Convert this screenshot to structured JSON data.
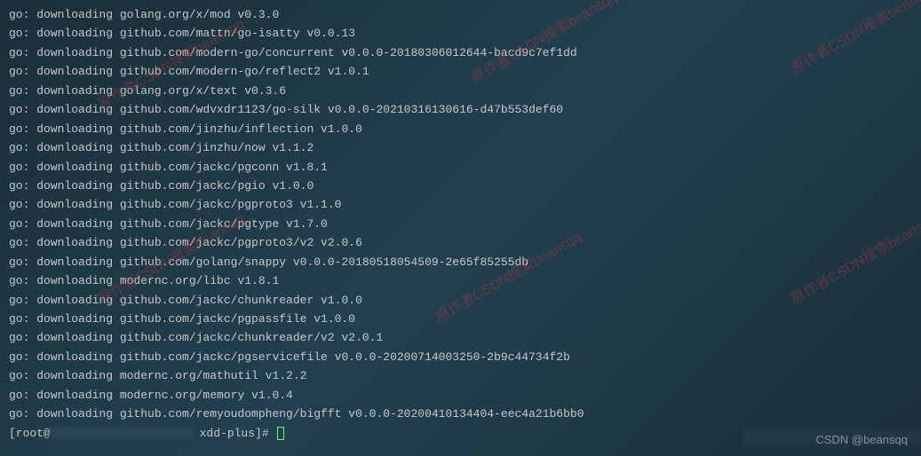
{
  "lines": [
    "go: downloading golang.org/x/mod v0.3.0",
    "go: downloading github.com/mattn/go-isatty v0.0.13",
    "go: downloading github.com/modern-go/concurrent v0.0.0-20180306012644-bacd9c7ef1dd",
    "go: downloading github.com/modern-go/reflect2 v1.0.1",
    "go: downloading golang.org/x/text v0.3.6",
    "go: downloading github.com/wdvxdr1123/go-silk v0.0.0-20210316130616-d47b553def60",
    "go: downloading github.com/jinzhu/inflection v1.0.0",
    "go: downloading github.com/jinzhu/now v1.1.2",
    "go: downloading github.com/jackc/pgconn v1.8.1",
    "go: downloading github.com/jackc/pgio v1.0.0",
    "go: downloading github.com/jackc/pgproto3 v1.1.0",
    "go: downloading github.com/jackc/pgtype v1.7.0",
    "go: downloading github.com/jackc/pgproto3/v2 v2.0.6",
    "go: downloading github.com/golang/snappy v0.0.0-20180518054509-2e65f85255db",
    "go: downloading modernc.org/libc v1.8.1",
    "go: downloading github.com/jackc/chunkreader v1.0.0",
    "go: downloading github.com/jackc/pgpassfile v1.0.0",
    "go: downloading github.com/jackc/chunkreader/v2 v2.0.1",
    "go: downloading github.com/jackc/pgservicefile v0.0.0-20200714003250-2b9c44734f2b",
    "go: downloading modernc.org/mathutil v1.2.2",
    "go: downloading modernc.org/memory v1.0.4",
    "go: downloading github.com/remyoudompheng/bigfft v0.0.0-20200410134404-eec4a21b6bb0"
  ],
  "prompt": {
    "user_open": "[root@",
    "dir": " xdd-plus]# "
  },
  "watermark_text": "原作者CSDN搜索beansqq",
  "csdn_attribution": "CSDN @beansqq"
}
